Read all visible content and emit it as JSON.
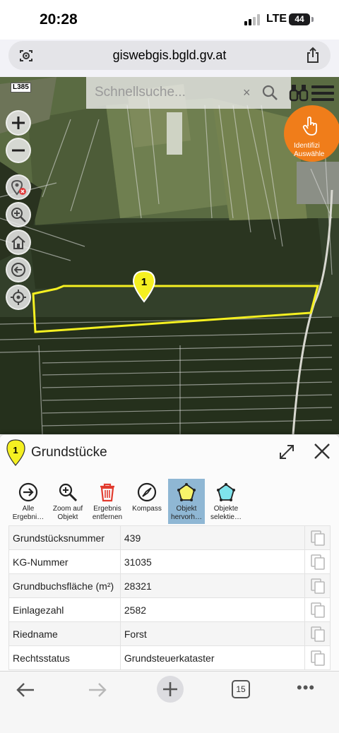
{
  "status_bar": {
    "time": "20:28",
    "network": "LTE",
    "battery": "44"
  },
  "browser": {
    "url": "giswebgis.bgld.gv.at",
    "tab_count": "15"
  },
  "map": {
    "road_label": "L385",
    "search_placeholder": "Schnellsuche...",
    "search_clear": "×",
    "identify_button": "Identifizieren Auswählen",
    "identify_line1": "Identifizi",
    "identify_line2": "Auswähle",
    "marker_number": "1",
    "controls": [
      "zoom-in",
      "zoom-out",
      "location-off",
      "zoom-area",
      "home",
      "back",
      "locate"
    ]
  },
  "panel": {
    "marker_number": "1",
    "title": "Grundstücke",
    "tools": [
      {
        "label": "Alle\nErgebni…",
        "icon": "arrow-right-circle-icon",
        "active": false
      },
      {
        "label": "Zoom auf\nObjekt",
        "icon": "zoom-in-icon",
        "active": false
      },
      {
        "label": "Ergebnis\nentfernen",
        "icon": "trash-icon",
        "active": false
      },
      {
        "label": "Kompass",
        "icon": "compass-icon",
        "active": false
      },
      {
        "label": "Objekt\nhervorh…",
        "icon": "highlight-polygon-icon",
        "active": true
      },
      {
        "label": "Objekte\nselektie…",
        "icon": "select-polygon-icon",
        "active": false
      }
    ],
    "attributes": [
      {
        "key": "Grundstücksnummer",
        "value": "439"
      },
      {
        "key": "KG-Nummer",
        "value": "31035"
      },
      {
        "key": "Grundbuchsfläche (m²)",
        "value": "28321"
      },
      {
        "key": "Einlagezahl",
        "value": "2582"
      },
      {
        "key": "Riedname",
        "value": "Forst"
      },
      {
        "key": "Rechtsstatus",
        "value": "Grundsteuerkataster"
      }
    ]
  },
  "colors": {
    "accent_orange": "#f07d1a",
    "highlight_yellow": "#f5f021",
    "active_tool": "#8fb7d4"
  }
}
